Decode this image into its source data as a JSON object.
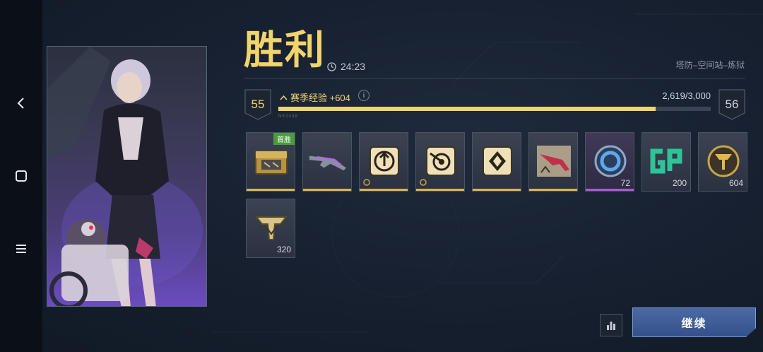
{
  "nav": {
    "back_icon": "chevron-left-icon",
    "home_icon": "square-icon",
    "menu_icon": "hamburger-menu-icon"
  },
  "result": {
    "title": "胜利",
    "duration": "24:23",
    "map": "塔防–空间站–炼狱"
  },
  "progress": {
    "current_level": "55",
    "next_level": "56",
    "xp_label": "赛季经验 +604",
    "info_label": "i",
    "xp_count": "2,619/3,000",
    "fill_fraction": 0.873,
    "bar_tag": "NE2048"
  },
  "rewards": [
    {
      "name": "reward-crate",
      "icon": "crate-icon",
      "qty": "",
      "badge": "首胜",
      "rarity": "gold"
    },
    {
      "name": "reward-weapon-purple",
      "icon": "rifle-icon",
      "qty": "",
      "badge": "",
      "rarity": "gold"
    },
    {
      "name": "reward-emblem-arrow",
      "icon": "arrow-emblem-icon",
      "qty": "",
      "badge": "",
      "rarity": "gold"
    },
    {
      "name": "reward-emblem-target",
      "icon": "target-emblem-icon",
      "qty": "",
      "badge": "",
      "rarity": "gold"
    },
    {
      "name": "reward-emblem-diamond",
      "icon": "diamond-emblem-icon",
      "qty": "",
      "badge": "",
      "rarity": "gold"
    },
    {
      "name": "reward-weapon-red",
      "icon": "rifle-blueprint-icon",
      "qty": "",
      "badge": "",
      "rarity": "gold"
    },
    {
      "name": "reward-blue-coin",
      "icon": "blue-coin-icon",
      "qty": "72",
      "badge": "",
      "rarity": "epic"
    },
    {
      "name": "reward-gp",
      "icon": "gp-icon",
      "qty": "200",
      "badge": "",
      "rarity": "plain"
    },
    {
      "name": "reward-gold-token",
      "icon": "gold-token-icon",
      "qty": "604",
      "badge": "",
      "rarity": "plain"
    },
    {
      "name": "reward-rank-badge",
      "icon": "rank-badge-icon",
      "qty": "320",
      "badge": "",
      "rarity": "plain"
    }
  ],
  "actions": {
    "stats_icon": "bar-chart-icon",
    "continue_label": "继续"
  },
  "colors": {
    "accent_gold": "#f2d46c",
    "epic_purple": "#b057d6",
    "button_blue": "#4b6aa4"
  }
}
